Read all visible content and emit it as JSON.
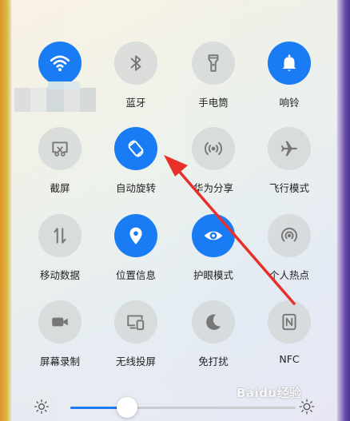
{
  "tiles": [
    {
      "label": "",
      "icon": "wifi-icon",
      "active": true
    },
    {
      "label": "蓝牙",
      "icon": "bluetooth-icon",
      "active": false
    },
    {
      "label": "手电筒",
      "icon": "flashlight-icon",
      "active": false
    },
    {
      "label": "响铃",
      "icon": "bell-icon",
      "active": true
    },
    {
      "label": "截屏",
      "icon": "screenshot-icon",
      "active": false
    },
    {
      "label": "自动旋转",
      "icon": "auto-rotate-icon",
      "active": true
    },
    {
      "label": "华为分享",
      "icon": "huawei-share-icon",
      "active": false
    },
    {
      "label": "飞行模式",
      "icon": "airplane-icon",
      "active": false
    },
    {
      "label": "移动数据",
      "icon": "mobile-data-icon",
      "active": false
    },
    {
      "label": "位置信息",
      "icon": "location-icon",
      "active": true
    },
    {
      "label": "护眼模式",
      "icon": "eye-icon",
      "active": true
    },
    {
      "label": "个人热点",
      "icon": "hotspot-icon",
      "active": false
    },
    {
      "label": "屏幕录制",
      "icon": "screen-record-icon",
      "active": false
    },
    {
      "label": "无线投屏",
      "icon": "wireless-projection-icon",
      "active": false
    },
    {
      "label": "免打扰",
      "icon": "moon-icon",
      "active": false
    },
    {
      "label": "NFC",
      "icon": "nfc-icon",
      "active": false
    }
  ],
  "brightness": {
    "level": 0.25
  },
  "colors": {
    "active": "#1a7cf5",
    "inactive": "#d2d6d6",
    "arrow": "#e8302a"
  },
  "watermark": "Baidu经验"
}
